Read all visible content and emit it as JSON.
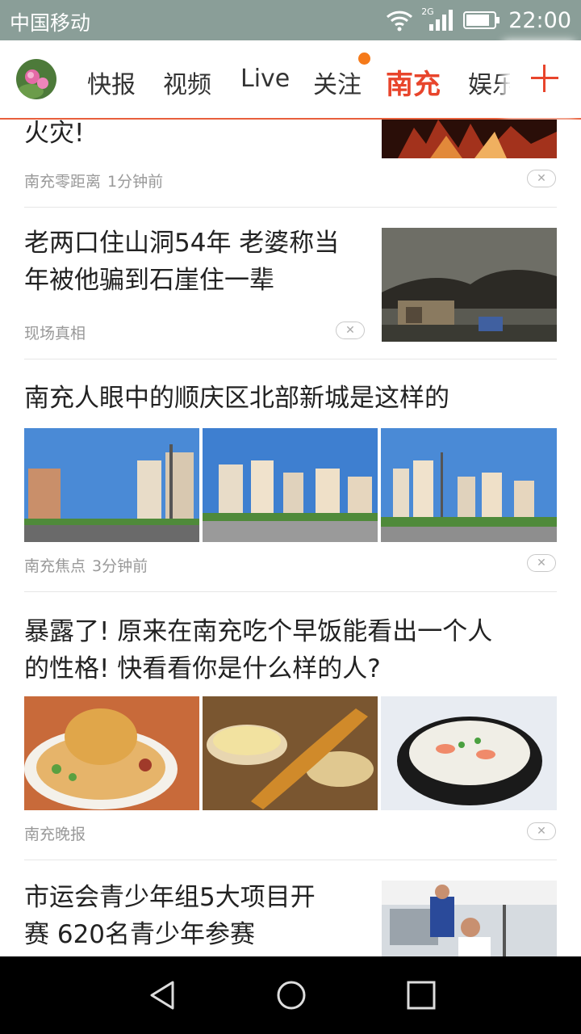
{
  "status_bar": {
    "carrier": "中国移动",
    "network": "2G",
    "time": "22:00"
  },
  "nav": {
    "tabs": [
      {
        "label": "快报"
      },
      {
        "label": "视频"
      },
      {
        "label": "Live"
      },
      {
        "label": "关注",
        "has_dot": true
      },
      {
        "label": "南充",
        "active": true
      },
      {
        "label": "娱乐"
      }
    ],
    "accent_color": "#e8452c"
  },
  "feed": [
    {
      "title_lines": [
        "火灾!"
      ],
      "source": "南充零距离",
      "time": "1分钟前",
      "thumb": "fire-photo"
    },
    {
      "title_lines": [
        "老两口住山洞54年 老婆称当",
        "年被他骗到石崖住一辈"
      ],
      "source": "现场真相",
      "time": "",
      "thumb": "cave-photo"
    },
    {
      "title_lines": [
        "南充人眼中的顺庆区北部新城是这样的"
      ],
      "source": "南充焦点",
      "time": "3分钟前",
      "thumbs": [
        "city-street-photo",
        "city-square-photo",
        "city-skyline-photo"
      ]
    },
    {
      "title_lines": [
        "暴露了! 原来在南充吃个早饭能看出一个人",
        "的性格! 快看看你是什么样的人?"
      ],
      "source": "南充晚报",
      "time": "",
      "thumbs": [
        "noodle-bowl-photo",
        "fried-dough-photo",
        "congee-photo"
      ]
    },
    {
      "title_lines": [
        "市运会青少年组5大项目开",
        "赛 620名青少年参赛"
      ],
      "source": "",
      "time": "",
      "thumb": "sports-photo"
    }
  ],
  "dismiss_symbol": "✕",
  "system_nav": {
    "buttons": [
      "back-icon",
      "home-icon",
      "recents-icon"
    ]
  }
}
